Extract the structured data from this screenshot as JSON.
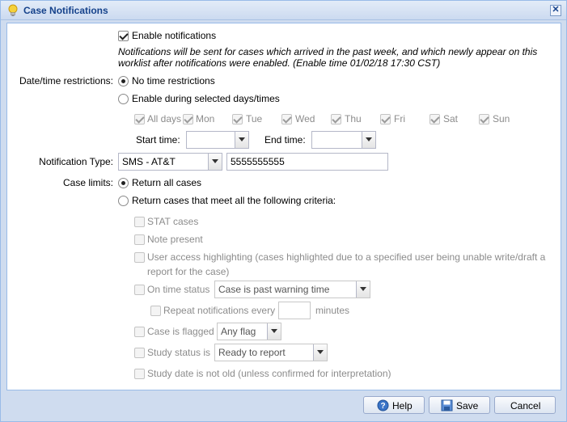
{
  "window": {
    "title": "Case Notifications",
    "title_icon": "lightbulb-icon",
    "close_glyph": "✕"
  },
  "enable": {
    "label": "Enable notifications",
    "note_line1": "Notifications will be sent for cases which arrived in the past week, and which newly appear on this",
    "note_line2": "worklist after notifications were enabled. (Enable time 01/02/18 17:30 CST)"
  },
  "datetime": {
    "label": "Date/time restrictions:",
    "no_restrictions": "No time restrictions",
    "selected_days": "Enable during selected days/times",
    "all_days": "All days",
    "days": [
      "Mon",
      "Tue",
      "Wed",
      "Thu",
      "Fri",
      "Sat",
      "Sun"
    ],
    "start_label": "Start time:",
    "end_label": "End time:",
    "start_value": "",
    "end_value": ""
  },
  "notification": {
    "label": "Notification Type:",
    "type_value": "SMS - AT&T",
    "number_value": "5555555555"
  },
  "limits": {
    "label": "Case limits:",
    "return_all": "Return all cases",
    "return_criteria": "Return cases that meet all the following criteria:",
    "stat": "STAT cases",
    "note_present": "Note present",
    "user_access_line1": "User access highlighting (cases highlighted due to a specified user being unable write/draft a",
    "user_access_line2": "report for the case)",
    "on_time": "On time status",
    "on_time_value": "Case is past warning time",
    "repeat": "Repeat notifications every",
    "repeat_value": "",
    "minutes": "minutes",
    "flagged": "Case is flagged",
    "flag_value": "Any flag",
    "study_status": "Study status is",
    "study_status_value": "Ready to report",
    "study_date": "Study date is not old (unless confirmed for interpretation)"
  },
  "buttons": {
    "help": "Help",
    "save": "Save",
    "cancel": "Cancel"
  },
  "colors": {
    "title_text": "#15428b",
    "border": "#99bbe8",
    "dialog_bg": "#cfdcef"
  }
}
